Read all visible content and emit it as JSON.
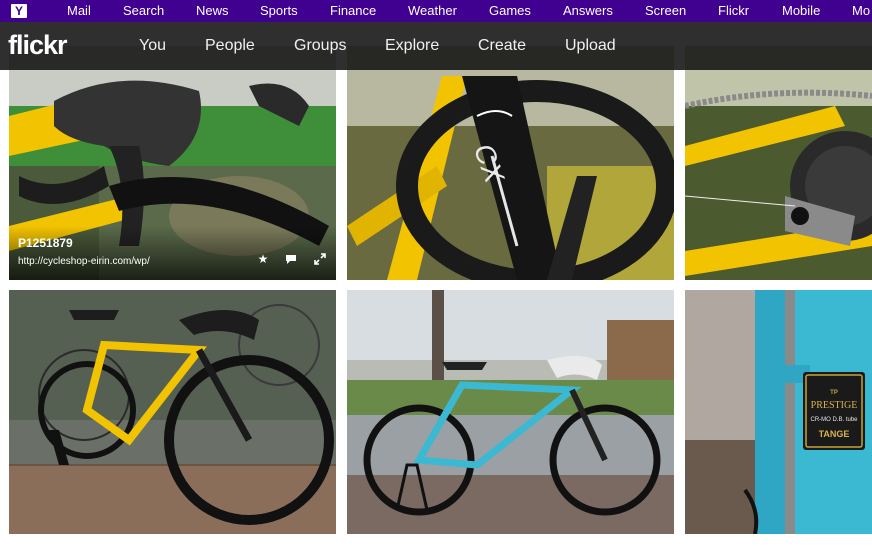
{
  "yahoo_bar": {
    "logo": "Y",
    "items": [
      "Mail",
      "Search",
      "News",
      "Sports",
      "Finance",
      "Weather",
      "Games",
      "Answers",
      "Screen",
      "Flickr",
      "Mobile",
      "Mo"
    ]
  },
  "flickr_nav": {
    "logo": "flickr",
    "items": [
      "You",
      "People",
      "Groups",
      "Explore",
      "Create",
      "Upload"
    ]
  },
  "photos": [
    {
      "title": "P1251879",
      "owner": "http://cycleshop-eirin.com/wp/",
      "actions": [
        "favorite-icon",
        "comment-icon",
        "expand-icon"
      ]
    }
  ],
  "frame_text": {
    "fork_brand": "CX",
    "tube_brand_top": "PRESTIGE",
    "tube_brand_mid": "CR-MO D.B. tube",
    "tube_brand_bottom": "TANGE"
  },
  "colors": {
    "yahoo_purple": "#400090",
    "flickr_bar": "#121212",
    "frame_yellow": "#f2c300",
    "frame_turquoise": "#3bb9d3"
  }
}
